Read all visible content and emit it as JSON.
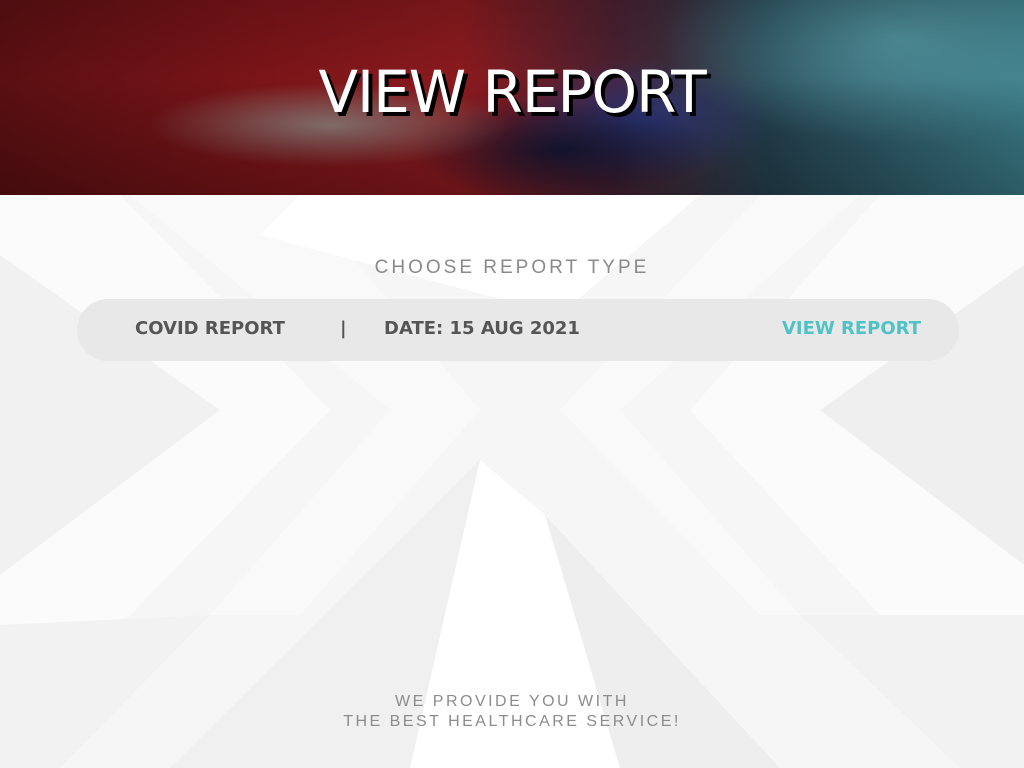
{
  "header": {
    "title": "VIEW REPORT"
  },
  "main": {
    "section_label": "CHOOSE REPORT TYPE",
    "report": {
      "type": "COVID REPORT",
      "separator": "|",
      "date": "DATE: 15 AUG 2021",
      "action_label": "VIEW REPORT"
    }
  },
  "footer": {
    "line1": "WE PROVIDE YOU WITH",
    "line2": "THE BEST HEALTHCARE SERVICE!"
  },
  "colors": {
    "accent": "#4fc2c6",
    "bar_background": "#e8e8e8",
    "muted_text": "#8a8a8a",
    "bar_text": "#555555"
  }
}
